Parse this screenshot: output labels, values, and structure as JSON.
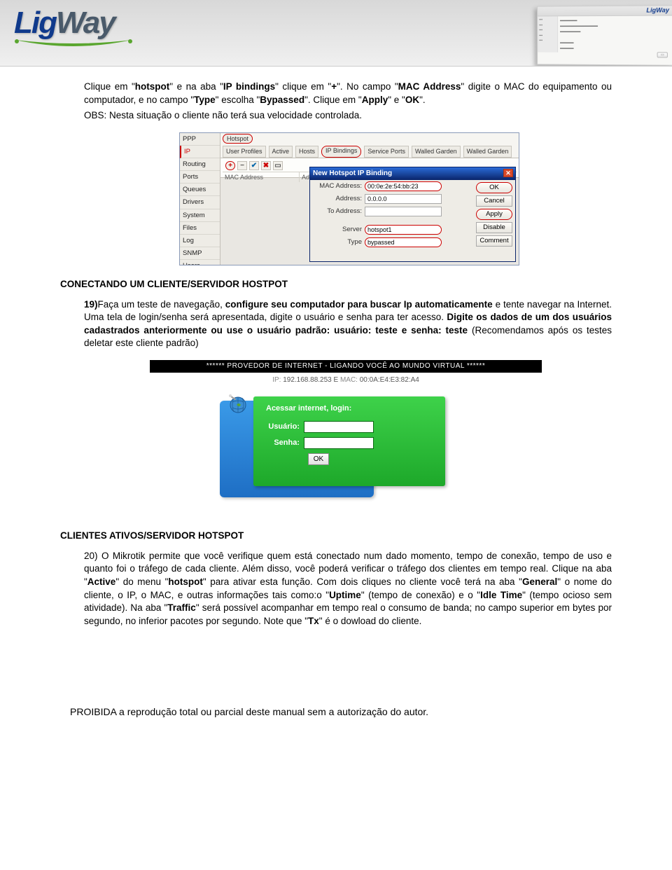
{
  "header": {
    "logo_lig": "Lig",
    "logo_way": "Way",
    "mini_logo": "LigWay"
  },
  "section1": {
    "p1a": "Clique em \"",
    "p1b": "hotspot",
    "p1c": "\" e na aba \"",
    "p1d": "IP bindings",
    "p1e": "\" clique em \"",
    "p1f": "+",
    "p1g": "\". No campo \"",
    "p1h": "MAC     Address",
    "p1i": "\" digite o MAC do equipamento ou computador, e no campo \"",
    "p1j": "Type",
    "p1k": "\" escolha \"",
    "p1l": "Bypassed",
    "p1m": "\". Clique em \"",
    "p1n": "Apply",
    "p1o": "\" e \"",
    "p1p": "OK",
    "p1q": "\".",
    "obs": "OBS: Nesta situação o cliente não terá sua velocidade controlada."
  },
  "mikrotik": {
    "menu": [
      "PPP",
      "IP",
      "Routing",
      "Ports",
      "Queues",
      "Drivers",
      "System",
      "Files",
      "Log",
      "SNMP",
      "Users"
    ],
    "tab_hotspot": "Hotspot",
    "tabs": [
      "User Profiles",
      "Active",
      "Hosts",
      "IP Bindings",
      "Service Ports",
      "Walled Garden",
      "Walled Garden"
    ],
    "tb_plus": "+",
    "tb_minus": "−",
    "tb_check": "✔",
    "tb_x": "✖",
    "grid_mac": "MAC Address",
    "grid_ad": "Ad",
    "dialog_title": "New Hotspot IP Binding",
    "fld_mac_label": "MAC Address:",
    "fld_mac_value": "00:0e:2e:54:bb:23",
    "fld_addr_label": "Address:",
    "fld_addr_value": "0.0.0.0",
    "fld_toaddr_label": "To Address:",
    "fld_server_label": "Server",
    "fld_server_value": "hotspot1",
    "fld_type_label": "Type",
    "fld_type_value": "bypassed",
    "btn_ok": "OK",
    "btn_cancel": "Cancel",
    "btn_apply": "Apply",
    "btn_disable": "Disable",
    "btn_comment": "Comment"
  },
  "section2": {
    "heading": "CONECTANDO UM CLIENTE/SERVIDOR HOSTPOT",
    "num": "19)",
    "t1": "Faça um teste de navegação, ",
    "t2": "configure seu computador para buscar Ip automaticamente",
    "t3": " e tente navegar na Internet. Uma tela de login/senha será apresentada, digite o usuário e senha para ter acesso. ",
    "t4": "Digite os dados de um dos usuários cadastrados anteriormente ou use o usuário padrão: usuário: teste e senha: teste",
    "t5": " (Recomendamos após os testes deletar este cliente padrão)"
  },
  "login": {
    "bar": "****** PROVEDOR DE INTERNET - LIGANDO VOCÊ AO MUNDO VIRTUAL ******",
    "ip_lbl": "IP:",
    "ip_val": " 192.168.88.253 E ",
    "mac_lbl": "MAC:",
    "mac_val": " 00:0A:E4:E3:82:A4",
    "title": "Acessar internet, login:",
    "user_label": "Usuário:",
    "pass_label": "Senha:",
    "ok": "OK"
  },
  "section3": {
    "heading": "CLIENTES ATIVOS/SERVIDOR HOTSPOT",
    "num": "20) ",
    "t1": "O Mikrotik permite que você verifique quem está conectado num dado momento, tempo de conexão, tempo de uso e quanto foi o tráfego de cada cliente. Além disso, você poderá verificar o tráfego dos clientes em tempo real. Clique na aba \"",
    "t2": "Active",
    "t3": "\" do menu \"",
    "t4": "hotspot",
    "t5": "\" para ativar esta função. Com dois cliques no cliente você terá na aba \"",
    "t6": "General",
    "t7": "\" o nome do cliente, o IP, o MAC, e outras informações tais como:o \"",
    "t8": "Uptime",
    "t9": "\" (tempo de conexão) e o \"",
    "t10": "Idle Time",
    "t11": "\" (tempo ocioso sem atividade). Na aba \"",
    "t12": "Traffic",
    "t13": "\" será possível acompanhar em tempo real o consumo de banda; no campo superior em bytes por segundo, no inferior pacotes por segundo. Note que \"",
    "t14": "Tx",
    "t15": "\" é o dowload do cliente."
  },
  "footer": "PROIBIDA a reprodução total ou parcial deste manual sem a autorização do autor."
}
